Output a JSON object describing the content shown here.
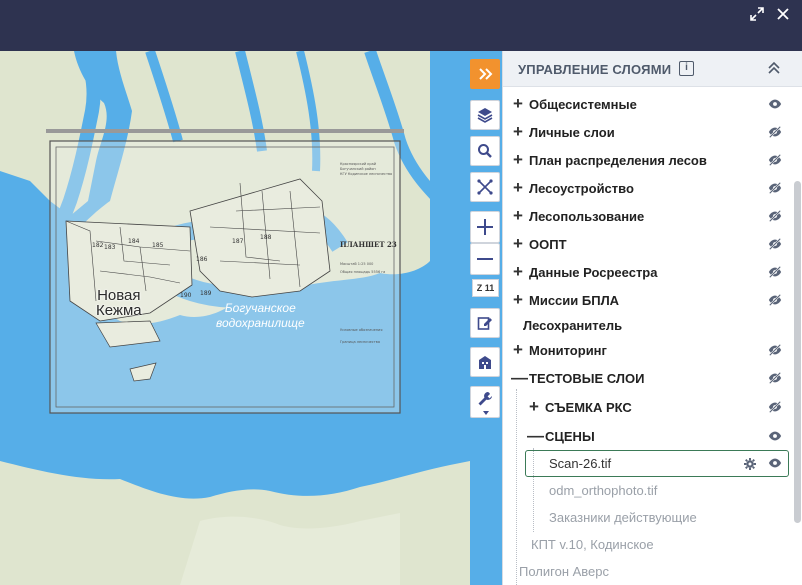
{
  "window": {
    "expand_icon": "expand-icon",
    "close_icon": "close-icon"
  },
  "map": {
    "city_label_line1": "Новая",
    "city_label_line2": "Кежма",
    "water_label_line1": "Богучанское",
    "water_label_line2": "водохранилище",
    "sheet_title": "ПЛАНШЕТ 23",
    "zoom_level": "Z 11"
  },
  "toolbar": {
    "collapse_icon": "double-chevron-right-icon",
    "layers_icon": "layers-icon",
    "search_icon": "search-icon",
    "measure_icon": "measure-icon",
    "zoom_in_icon": "plus-icon",
    "zoom_out_icon": "minus-icon",
    "edit_icon": "edit-icon",
    "print_icon": "building-icon",
    "tools_icon": "wrench-icon"
  },
  "panel": {
    "title": "УПРАВЛЕНИЕ СЛОЯМИ",
    "info_icon": "i",
    "layers": [
      {
        "sign": "+",
        "label": "Общесистемные",
        "eye": "visible"
      },
      {
        "sign": "+",
        "label": "Личные слои",
        "eye": "hidden"
      },
      {
        "sign": "+",
        "label": "План распределения лесов",
        "eye": "hidden"
      },
      {
        "sign": "+",
        "label": "Лесоустройство",
        "eye": "hidden"
      },
      {
        "sign": "+",
        "label": "Лесопользование",
        "eye": "hidden"
      },
      {
        "sign": "+",
        "label": "ООПТ",
        "eye": "hidden"
      },
      {
        "sign": "+",
        "label": "Данные Росреестра",
        "eye": "hidden"
      },
      {
        "sign": "+",
        "label": "Миссии БПЛА",
        "eye": "hidden"
      },
      {
        "sign": "",
        "label": "Лесохранитель",
        "eye": "none"
      },
      {
        "sign": "+",
        "label": "Мониторинг",
        "eye": "hidden"
      },
      {
        "sign": "—",
        "label": "ТЕСТОВЫЕ СЛОИ",
        "eye": "hidden"
      },
      {
        "sign": "+",
        "label": "СЪЕМКА РКС",
        "eye": "hidden"
      },
      {
        "sign": "—",
        "label": "СЦЕНЫ",
        "eye": "visible"
      },
      {
        "sign": "",
        "label": "Scan-26.tif",
        "eye": "visible"
      },
      {
        "sign": "",
        "label": "odm_orthophoto.tif",
        "eye": "none"
      },
      {
        "sign": "",
        "label": "Заказники действующие",
        "eye": "none"
      },
      {
        "sign": "",
        "label": "КПТ v.10, Кодинское",
        "eye": "none"
      },
      {
        "sign": "",
        "label": "Полигон Аверс",
        "eye": "none"
      }
    ]
  },
  "colors": {
    "header_bg": "#2e3350",
    "water": "#56aee8",
    "land": "#dfe5cf",
    "accent_orange": "#f2922e",
    "selected_border": "#3b7a57"
  }
}
